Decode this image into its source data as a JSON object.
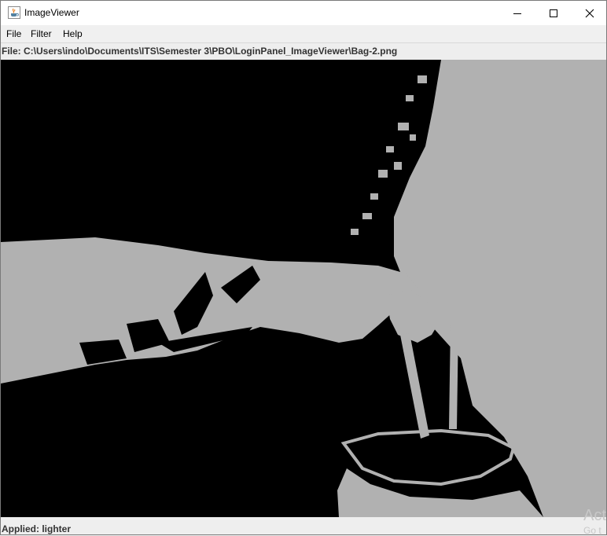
{
  "window": {
    "title": "ImageViewer",
    "app_icon": "java-cup-icon",
    "controls": {
      "minimize": "minimize-icon",
      "maximize": "maximize-icon",
      "close": "close-icon"
    }
  },
  "menubar": {
    "items": [
      {
        "label": "File"
      },
      {
        "label": "Filter"
      },
      {
        "label": "Help"
      }
    ]
  },
  "file_info": {
    "text": "File: C:\\Users\\indo\\Documents\\ITS\\Semester 3\\PBO\\LoginPanel_ImageViewer\\Bag-2.png"
  },
  "image": {
    "filter_applied": "lighter",
    "foreground_color": "#b1b1b1",
    "background_color": "#000000"
  },
  "status": {
    "text": "Applied: lighter"
  },
  "watermark": {
    "line1": "Act",
    "line2": "Go t"
  }
}
